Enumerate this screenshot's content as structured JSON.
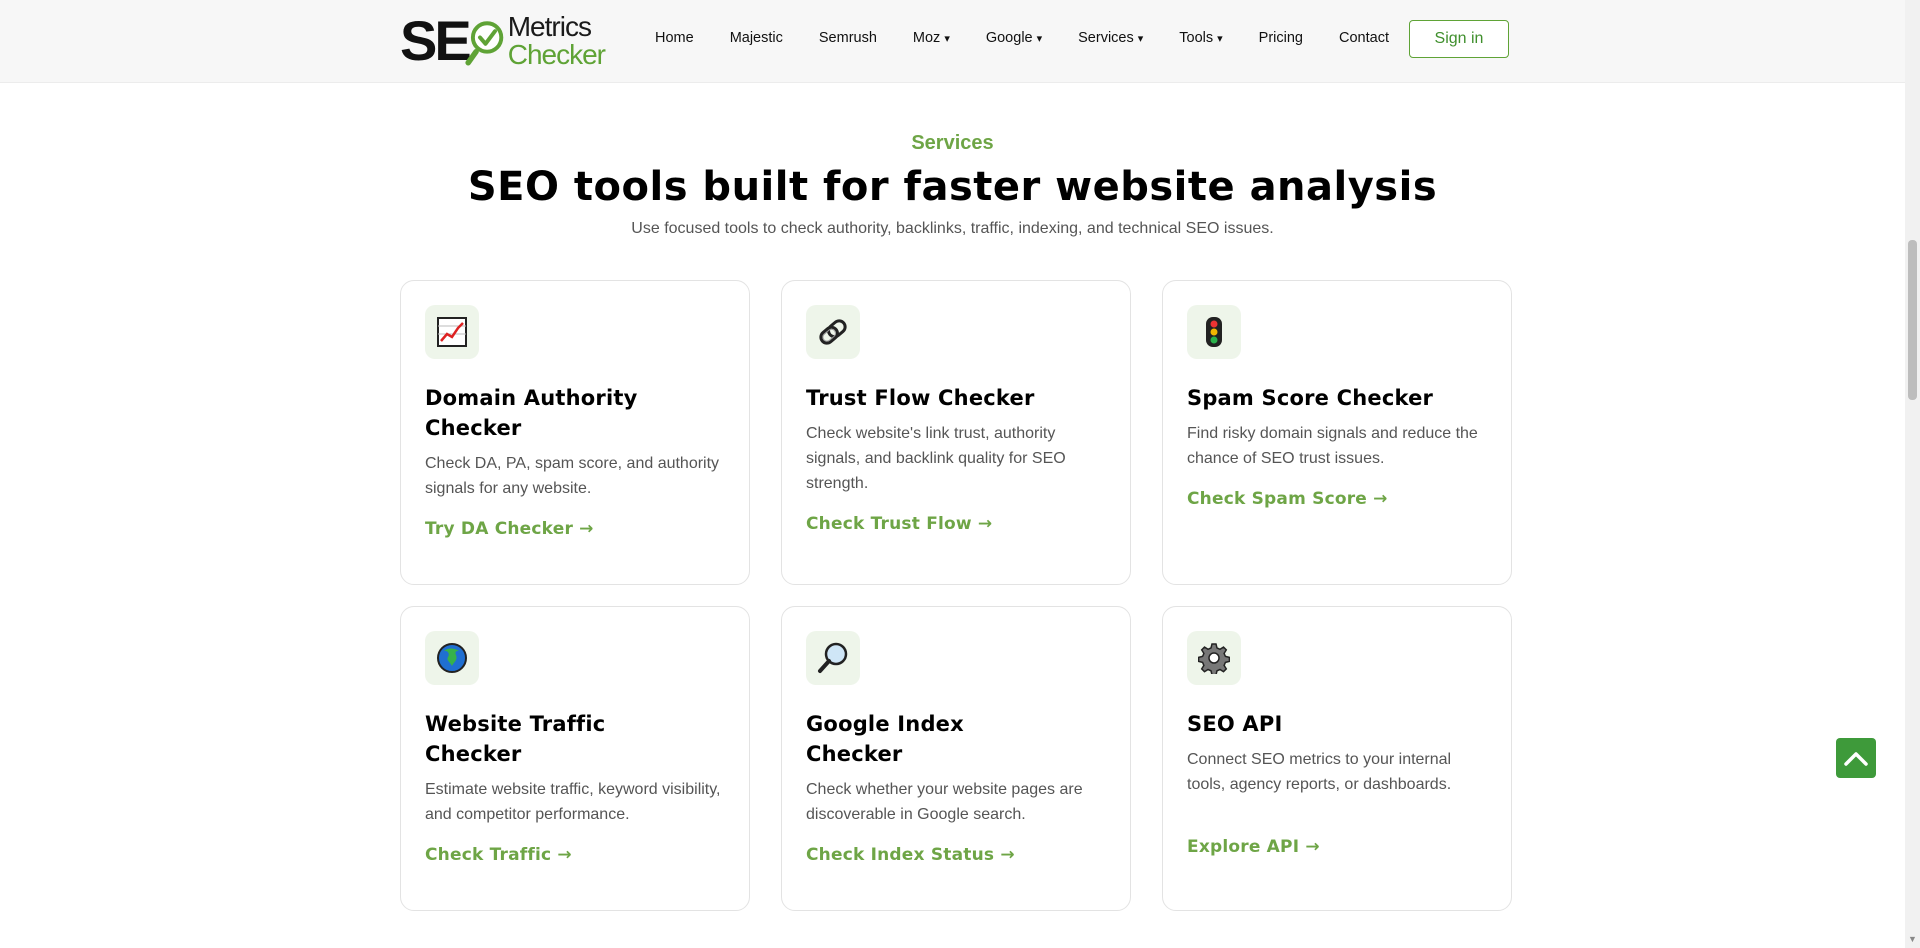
{
  "header": {
    "logo": {
      "part1": "SE",
      "part2": "Metrics",
      "part3": "Checker"
    },
    "nav": [
      {
        "label": "Home",
        "dropdown": false
      },
      {
        "label": "Majestic",
        "dropdown": false
      },
      {
        "label": "Semrush",
        "dropdown": false
      },
      {
        "label": "Moz",
        "dropdown": true
      },
      {
        "label": "Google",
        "dropdown": true
      },
      {
        "label": "Services",
        "dropdown": true
      },
      {
        "label": "Tools",
        "dropdown": true
      },
      {
        "label": "Pricing",
        "dropdown": false
      },
      {
        "label": "Contact",
        "dropdown": false
      }
    ],
    "signin_label": "Sign in",
    "caret": "▾"
  },
  "section": {
    "eyebrow": "Services",
    "title": "SEO tools built for faster website analysis",
    "subtitle": "Use focused tools to check authority, backlinks, traffic, indexing, and technical SEO issues."
  },
  "cards": [
    {
      "icon": "chart-icon",
      "title": "Domain Authority Checker",
      "desc": "Check DA, PA, spam score, and authority signals for any website.",
      "link": "Try DA Checker →"
    },
    {
      "icon": "link-icon",
      "title": "Trust Flow Checker",
      "desc": "Check website's link trust, authority signals, and backlink quality for SEO strength.",
      "link": "Check Trust Flow →"
    },
    {
      "icon": "traffic-light-icon",
      "title": "Spam Score Checker",
      "desc": "Find risky domain signals and reduce the chance of SEO trust issues.",
      "link": "Check Spam Score →"
    },
    {
      "icon": "globe-icon",
      "title": "Website Traffic Checker",
      "desc": "Estimate website traffic, keyword visibility, and competitor performance.",
      "link": "Check Traffic →"
    },
    {
      "icon": "magnifier-icon",
      "title": "Google Index Checker",
      "desc": "Check whether your website pages are discoverable in Google search.",
      "link": "Check Index Status →"
    },
    {
      "icon": "gear-icon",
      "title": "SEO API",
      "desc": "Connect SEO metrics to your internal tools, agency reports, or dashboards.",
      "link": "Explore API →"
    }
  ],
  "colors": {
    "accent": "#6ea546",
    "brand_green": "#3e9a3a",
    "icon_bg": "#eef5ea"
  }
}
